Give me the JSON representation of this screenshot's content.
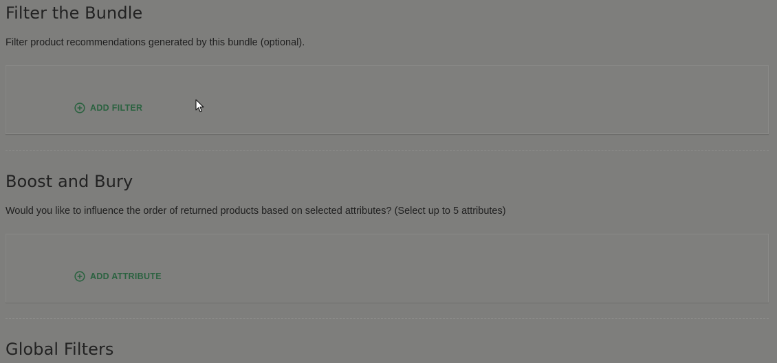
{
  "sections": [
    {
      "title": "Filter the Bundle",
      "description": "Filter product recommendations generated by this bundle (optional).",
      "action_label": "ADD FILTER"
    },
    {
      "title": "Boost and Bury",
      "description": "Would you like to influence the order of returned products based on selected attributes? (Select up to 5 attributes)",
      "action_label": "ADD ATTRIBUTE"
    },
    {
      "title": "Global Filters"
    }
  ],
  "icons": {
    "add": "plus-circle-icon",
    "cursor": "mouse-pointer-icon"
  },
  "colors": {
    "accent": "#2b6240",
    "overlay_background": "#7e7e7c"
  }
}
